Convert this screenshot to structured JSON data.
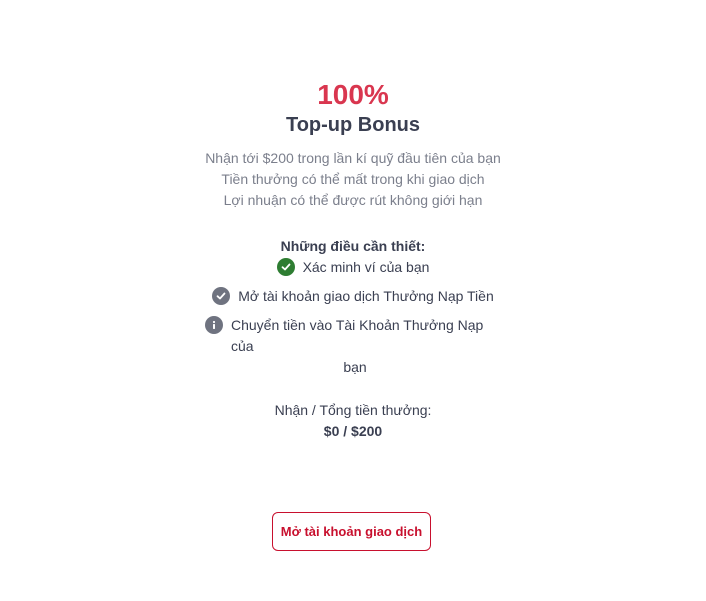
{
  "bonus": {
    "percent": "100%",
    "title": "Top-up Bonus",
    "description": [
      "Nhận tới $200 trong lần kí quỹ đầu tiên của bạn",
      "Tiền thưởng có thể mất trong khi giao dịch",
      "Lợi nhuận có thể được rút không giới hạn"
    ]
  },
  "requirements": {
    "title": "Những điều cần thiết:",
    "items": [
      {
        "label": "Xác minh ví của bạn",
        "icon": "check-circle-icon",
        "status": "done",
        "color": "#2e7d32"
      },
      {
        "label": "Mở tài khoản giao dịch Thưởng Nạp Tiền",
        "icon": "check-circle-icon",
        "status": "pending",
        "color": "#6f7380"
      },
      {
        "label_line1": "Chuyển tiền vào Tài Khoản Thưởng Nạp của",
        "label_line2": "bạn",
        "icon": "info-circle-icon",
        "status": "info",
        "color": "#6f7380"
      }
    ]
  },
  "progress": {
    "label": "Nhận / Tổng tiền thưởng:",
    "value": "$0 / $200"
  },
  "actions": {
    "open_account_label": "Mở tài khoản giao dịch"
  },
  "colors": {
    "accent": "#d9364f",
    "button": "#c8102e",
    "success": "#2e7d32",
    "muted": "#6f7380"
  }
}
